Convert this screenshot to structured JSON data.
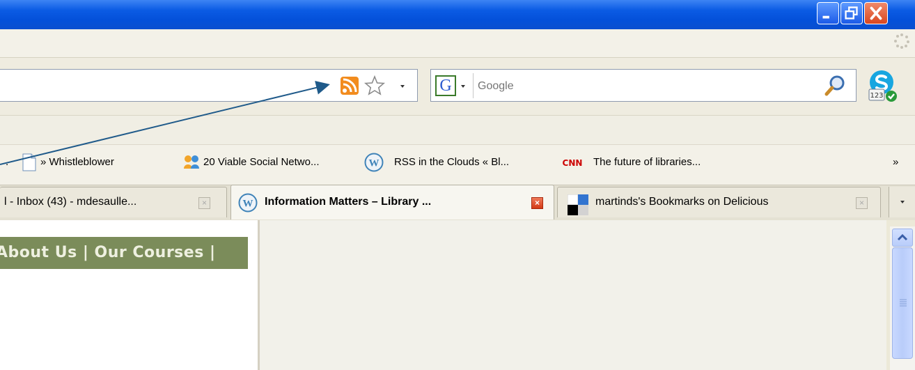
{
  "search": {
    "placeholder": "Google",
    "engine_letter": "G"
  },
  "bookmarks": {
    "items": [
      {
        "label": "» Whistleblower"
      },
      {
        "label": "20 Viable Social Netwo..."
      },
      {
        "label": "RSS in the Clouds « Bl..."
      },
      {
        "label": "The future of libraries..."
      }
    ],
    "leading": ".",
    "overflow": "»"
  },
  "tabs": [
    {
      "label": "l - Inbox (43) - mdesaulle..."
    },
    {
      "label": "Information Matters – Library ..."
    },
    {
      "label": "martinds's Bookmarks on Delicious"
    }
  ],
  "page": {
    "nav_text": "About Us | Our Courses |"
  },
  "colors": {
    "titlebar": "#0b5be4",
    "arrow": "#1f5a8a",
    "rss": "#f28c1e",
    "nav_strip": "#7b8c5a",
    "cnn": "#cc0000"
  },
  "icons": {
    "rss": "rss-feed-icon",
    "star": "bookmark-star-icon",
    "search": "magnifier-icon",
    "skype": "skype-icon"
  }
}
